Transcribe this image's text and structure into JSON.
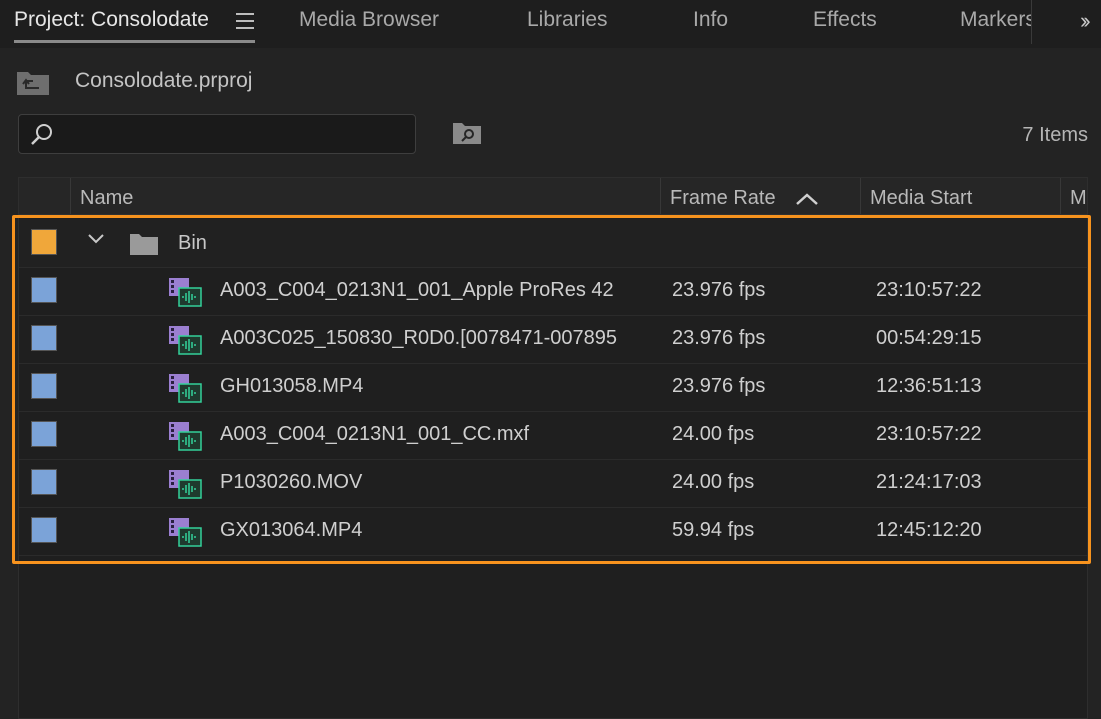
{
  "tabs": [
    {
      "label": "Project: Consolodate",
      "active": true
    },
    {
      "label": "Media Browser"
    },
    {
      "label": "Libraries"
    },
    {
      "label": "Info"
    },
    {
      "label": "Effects"
    },
    {
      "label": "Markers"
    }
  ],
  "project": {
    "filename": "Consolodate.prproj",
    "items_count": "7 Items",
    "search_value": ""
  },
  "columns": {
    "name": "Name",
    "frame_rate": "Frame Rate",
    "media_start": "Media Start",
    "next": "M"
  },
  "bin": {
    "label": "Bin",
    "color": "#f0a73a"
  },
  "clips": [
    {
      "name": "A003_C004_0213N1_001_Apple ProRes 42",
      "fps": "23.976 fps",
      "start": "23:10:57:22",
      "color": "#7ba3d8"
    },
    {
      "name": "A003C025_150830_R0D0.[0078471-007895",
      "fps": "23.976 fps",
      "start": "00:54:29:15",
      "color": "#7ba3d8"
    },
    {
      "name": "GH013058.MP4",
      "fps": "23.976 fps",
      "start": "12:36:51:13",
      "color": "#7ba3d8"
    },
    {
      "name": "A003_C004_0213N1_001_CC.mxf",
      "fps": "24.00 fps",
      "start": "23:10:57:22",
      "color": "#7ba3d8"
    },
    {
      "name": "P1030260.MOV",
      "fps": "24.00 fps",
      "start": "21:24:17:03",
      "color": "#7ba3d8"
    },
    {
      "name": "GX013064.MP4",
      "fps": "59.94 fps",
      "start": "12:45:12:20",
      "color": "#7ba3d8"
    }
  ],
  "highlight_color": "#f7931e"
}
